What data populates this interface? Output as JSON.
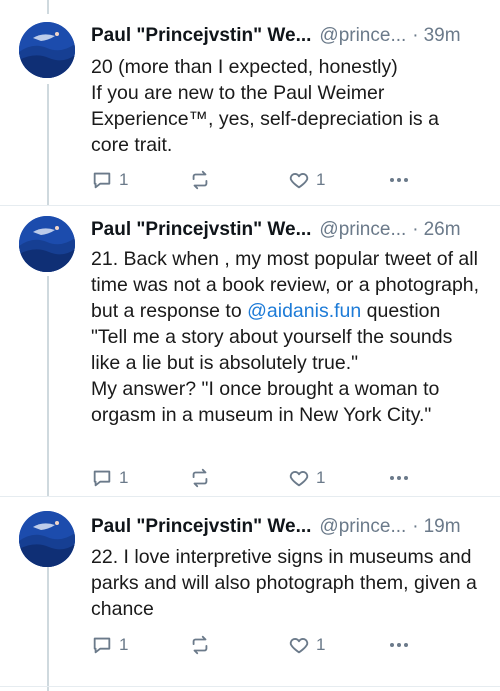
{
  "posts": [
    {
      "author_name": "Paul \"Princejvstin\" We...",
      "handle": "@prince...",
      "separator": "·",
      "time": "39m",
      "lines": [
        "20 (more than I expected, honestly)",
        "If you are new to the Paul Weimer Experience™, yes, self-depreciation is a core trait."
      ],
      "reply_count": "1",
      "like_count": "1"
    },
    {
      "author_name": "Paul \"Princejvstin\" We...",
      "handle": "@prince...",
      "separator": "·",
      "time": "26m",
      "line1": "21.  Back when , my most popular tweet of all time was not a book review, or a photograph, but a response to",
      "mention": "@aidanis.fun",
      "line1_rest": " question \"Tell me a story about yourself the sounds like a lie but is absolutely true.\"",
      "line2": "My answer? \"I once brought a woman to orgasm in a museum in New York City.\"",
      "reply_count": "1",
      "like_count": "1"
    },
    {
      "author_name": "Paul \"Princejvstin\" We...",
      "handle": "@prince...",
      "separator": "·",
      "time": "19m",
      "lines": [
        "22. I love interpretive signs in museums and parks and will also photograph them, given a chance"
      ],
      "reply_count": "1",
      "like_count": "1"
    }
  ],
  "icons": {
    "reply": "reply-icon",
    "repost": "repost-icon",
    "like": "heart-icon",
    "more": "more-icon"
  },
  "colors": {
    "mention": "#1d7bd7",
    "muted": "#6b7a8a",
    "thread_line": "#cfd9de"
  }
}
